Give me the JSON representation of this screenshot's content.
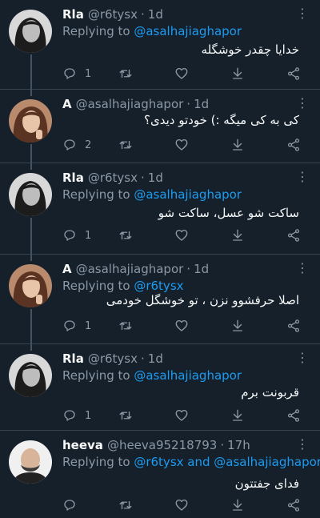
{
  "tweets": [
    {
      "name": "Rla",
      "handle": "@r6tysx",
      "dot": "·",
      "time": "1d",
      "replying_prefix": "Replying to ",
      "replying_to": "@asalhajiaghapor",
      "replying_mid": "",
      "replying_to2": "",
      "text": "خدایا چقدر خوشگله",
      "reply_count": "1",
      "more": "⋮"
    },
    {
      "name": "A",
      "handle": "@asalhajiaghapor",
      "dot": "·",
      "time": "1d",
      "replying_prefix": "",
      "replying_to": "",
      "replying_mid": "",
      "replying_to2": "",
      "text": "کی به کی میگه :) خودتو دیدی؟",
      "reply_count": "2",
      "more": "⋮"
    },
    {
      "name": "Rla",
      "handle": "@r6tysx",
      "dot": "·",
      "time": "1d",
      "replying_prefix": "Replying to ",
      "replying_to": "@asalhajiaghapor",
      "replying_mid": "",
      "replying_to2": "",
      "text": "ساکت شو عسل، ساکت شو",
      "reply_count": "1",
      "more": "⋮"
    },
    {
      "name": "A",
      "handle": "@asalhajiaghapor",
      "dot": "·",
      "time": "1d",
      "replying_prefix": "Replying to ",
      "replying_to": "@r6tysx",
      "replying_mid": "",
      "replying_to2": "",
      "text": "اصلا حرفشوو نزن ، تو خوشگل خودمی",
      "reply_count": "1",
      "more": "⋮"
    },
    {
      "name": "Rla",
      "handle": "@r6tysx",
      "dot": "·",
      "time": "1d",
      "replying_prefix": "Replying to ",
      "replying_to": "@asalhajiaghapor",
      "replying_mid": "",
      "replying_to2": "",
      "text": "قربونت برم",
      "reply_count": "1",
      "more": "⋮"
    },
    {
      "name": "heeva",
      "handle": "@heeva95218793",
      "dot": "·",
      "time": "17h",
      "replying_prefix": "Replying to ",
      "replying_to": "@r6tysx",
      "replying_mid": " and ",
      "replying_to2": "@asalhajiaghapor",
      "text": "فدای جفتتون",
      "reply_count": "",
      "more": "⋮"
    }
  ],
  "colors": {
    "background": "#15202b",
    "text": "#f7f9f9",
    "secondary": "#8b98a5",
    "link": "#1d9bf0",
    "divider": "#38444d"
  },
  "icons": [
    "reply-icon",
    "retweet-icon",
    "like-icon",
    "download-icon",
    "share-icon",
    "more-icon"
  ]
}
